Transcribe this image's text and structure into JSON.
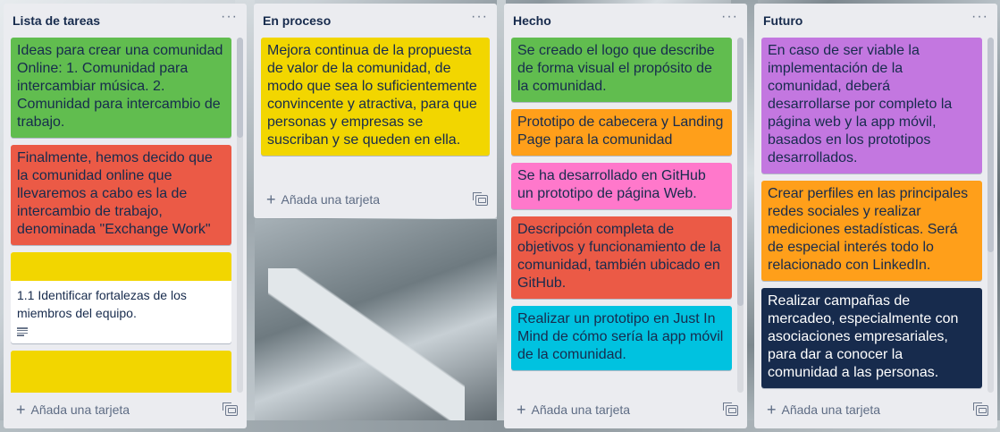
{
  "colors": {
    "list_bg": "#ebecf0",
    "green": "#61bd4f",
    "red": "#eb5a46",
    "yellow": "#f2d600",
    "orange": "#ff9f1a",
    "pink": "#ff78cb",
    "sky": "#00c2e0",
    "purple": "#c377e0",
    "navy": "#172b4d",
    "white": "#ffffff"
  },
  "add_card_label": "Añada una tarjeta",
  "menu_glyph": "···",
  "plus_glyph": "+",
  "lists": [
    {
      "title": "Lista de tareas",
      "cards": [
        {
          "text": "Ideas para crear una comunidad Online: 1. Comunidad para intercambiar música. 2. Comunidad para intercambio de trabajo.",
          "color": "green"
        },
        {
          "text": "Finalmente, hemos decido que la comunidad online que llevaremos a cabo es la de intercambio de trabajo, denominada \"Exchange Work\"",
          "color": "red"
        },
        {
          "text": "1.1 Identificar fortalezas de los miembros del equipo.",
          "color": "white",
          "cover": "yellow",
          "icon": "description-icon"
        },
        {
          "text": "",
          "color": "yellow"
        }
      ]
    },
    {
      "title": "En proceso",
      "cards": [
        {
          "text": "Mejora continua de la propuesta de valor de la comunidad, de modo que sea lo suficientemente convincente y atractiva, para que personas y empresas se suscriban y se queden en ella.",
          "color": "yellow"
        }
      ]
    },
    {
      "title": "Hecho",
      "cards": [
        {
          "text": "Se creado el logo que describe de forma visual el propósito de la comunidad.",
          "color": "green"
        },
        {
          "text": "Prototipo de cabecera y Landing Page para la comunidad",
          "color": "orange"
        },
        {
          "text": "Se ha desarrollado en GitHub un prototipo de página Web.",
          "color": "pink"
        },
        {
          "text": "Descripción completa de objetivos y funcionamiento de la comunidad, también ubicado en GitHub.",
          "color": "red"
        },
        {
          "text": "Realizar un prototipo en Just In Mind de cómo sería la app móvil de la comunidad.",
          "color": "sky"
        }
      ]
    },
    {
      "title": "Futuro",
      "cards": [
        {
          "text": "En caso de ser viable la implementación de la comunidad, deberá desarrollarse por completo la página web y la app móvil, basados en los prototipos desarrollados.",
          "color": "purple"
        },
        {
          "text": "Crear perfiles en las principales redes sociales y realizar mediciones estadísticas. Será de especial interés todo lo relacionado con LinkedIn.",
          "color": "orange"
        },
        {
          "text": "Realizar campañas de mercadeo, especialmente con asociaciones empresariales, para dar a conocer la comunidad a las personas.",
          "color": "navy"
        }
      ]
    }
  ]
}
